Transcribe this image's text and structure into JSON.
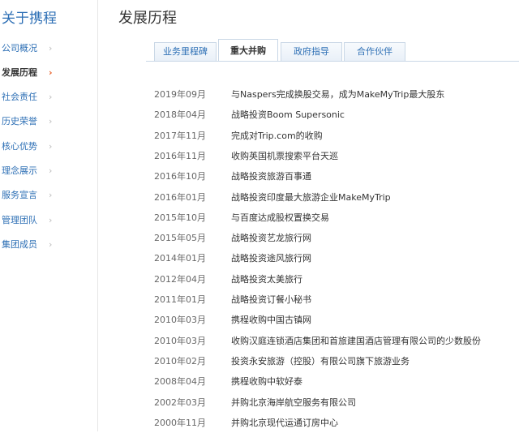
{
  "sidebar": {
    "title": "关于携程",
    "items": [
      {
        "label": "公司概况",
        "active": false
      },
      {
        "label": "发展历程",
        "active": true
      },
      {
        "label": "社会责任",
        "active": false
      },
      {
        "label": "历史荣誉",
        "active": false
      },
      {
        "label": "核心优势",
        "active": false
      },
      {
        "label": "理念展示",
        "active": false
      },
      {
        "label": "服务宣言",
        "active": false
      },
      {
        "label": "管理团队",
        "active": false
      },
      {
        "label": "集团成员",
        "active": false
      }
    ],
    "chevron": "›"
  },
  "main": {
    "title": "发展历程",
    "tabs": [
      {
        "label": "业务里程碑",
        "active": false
      },
      {
        "label": "重大并购",
        "active": true
      },
      {
        "label": "政府指导",
        "active": false
      },
      {
        "label": "合作伙伴",
        "active": false
      }
    ],
    "rows": [
      {
        "date": "2019年09月",
        "event": "与Naspers完成换股交易，成为MakeMyTrip最大股东"
      },
      {
        "date": "2018年04月",
        "event": "战略投资Boom Supersonic"
      },
      {
        "date": "2017年11月",
        "event": "完成对Trip.com的收购"
      },
      {
        "date": "2016年11月",
        "event": "收购英国机票搜索平台天巡"
      },
      {
        "date": "2016年10月",
        "event": "战略投资旅游百事通"
      },
      {
        "date": "2016年01月",
        "event": "战略投资印度最大旅游企业MakeMyTrip"
      },
      {
        "date": "2015年10月",
        "event": "与百度达成股权置换交易"
      },
      {
        "date": "2015年05月",
        "event": "战略投资艺龙旅行网"
      },
      {
        "date": "2014年01月",
        "event": "战略投资途风旅行网"
      },
      {
        "date": "2012年04月",
        "event": "战略投资太美旅行"
      },
      {
        "date": "2011年01月",
        "event": "战略投资订餐小秘书"
      },
      {
        "date": "2010年03月",
        "event": "携程收购中国古镇网"
      },
      {
        "date": "2010年03月",
        "event": "收购汉庭连锁酒店集团和首旅建国酒店管理有限公司的少数股份"
      },
      {
        "date": "2010年02月",
        "event": "投资永安旅游（控股）有限公司旗下旅游业务"
      },
      {
        "date": "2008年04月",
        "event": "携程收购中软好泰"
      },
      {
        "date": "2002年03月",
        "event": "并购北京海岸航空服务有限公司"
      },
      {
        "date": "2000年11月",
        "event": "并购北京现代运通订房中心"
      }
    ]
  }
}
